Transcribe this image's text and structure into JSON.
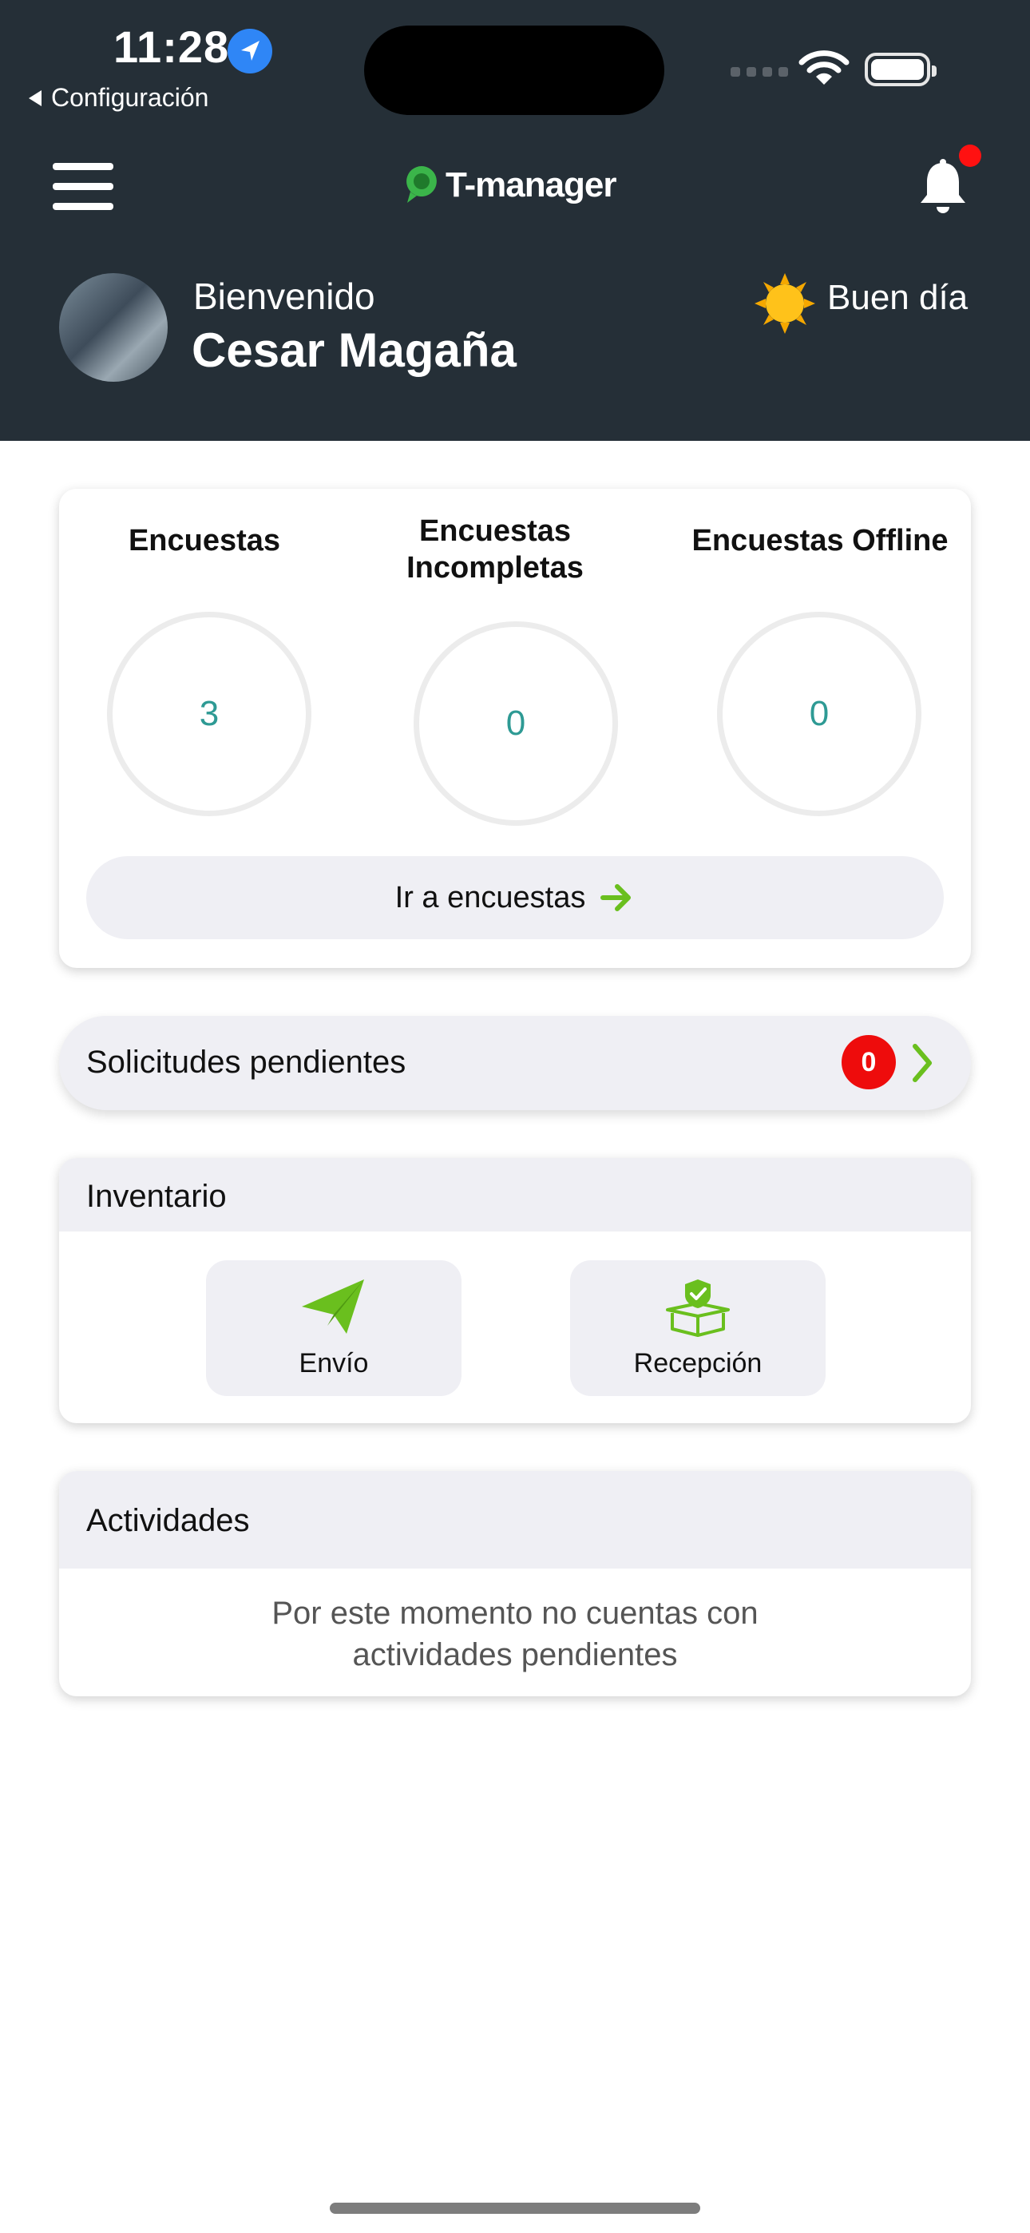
{
  "status_bar": {
    "time": "11:28",
    "back_label": "Configuración"
  },
  "header": {
    "app_name": "T-manager",
    "has_notification": true
  },
  "user": {
    "welcome": "Bienvenido",
    "name": "Cesar Magaña",
    "greeting": "Buen día"
  },
  "surveys": {
    "stats": [
      {
        "title": "Encuestas",
        "value": "3"
      },
      {
        "title": "Encuestas Incompletas",
        "value": "0"
      },
      {
        "title": "Encuestas Offline",
        "value": "0"
      }
    ],
    "cta_label": "Ir a encuestas"
  },
  "pending": {
    "label": "Solicitudes pendientes",
    "count": "0"
  },
  "inventory": {
    "title": "Inventario",
    "buttons": [
      {
        "label": "Envío"
      },
      {
        "label": "Recepción"
      }
    ]
  },
  "activities": {
    "title": "Actividades",
    "empty_message": "Por este momento no cuentas con actividades pendientes"
  },
  "colors": {
    "topbar": "#252f37",
    "accent_green": "#6abf1e",
    "badge_red": "#ee0c0c",
    "value_teal": "#2e9a94"
  }
}
